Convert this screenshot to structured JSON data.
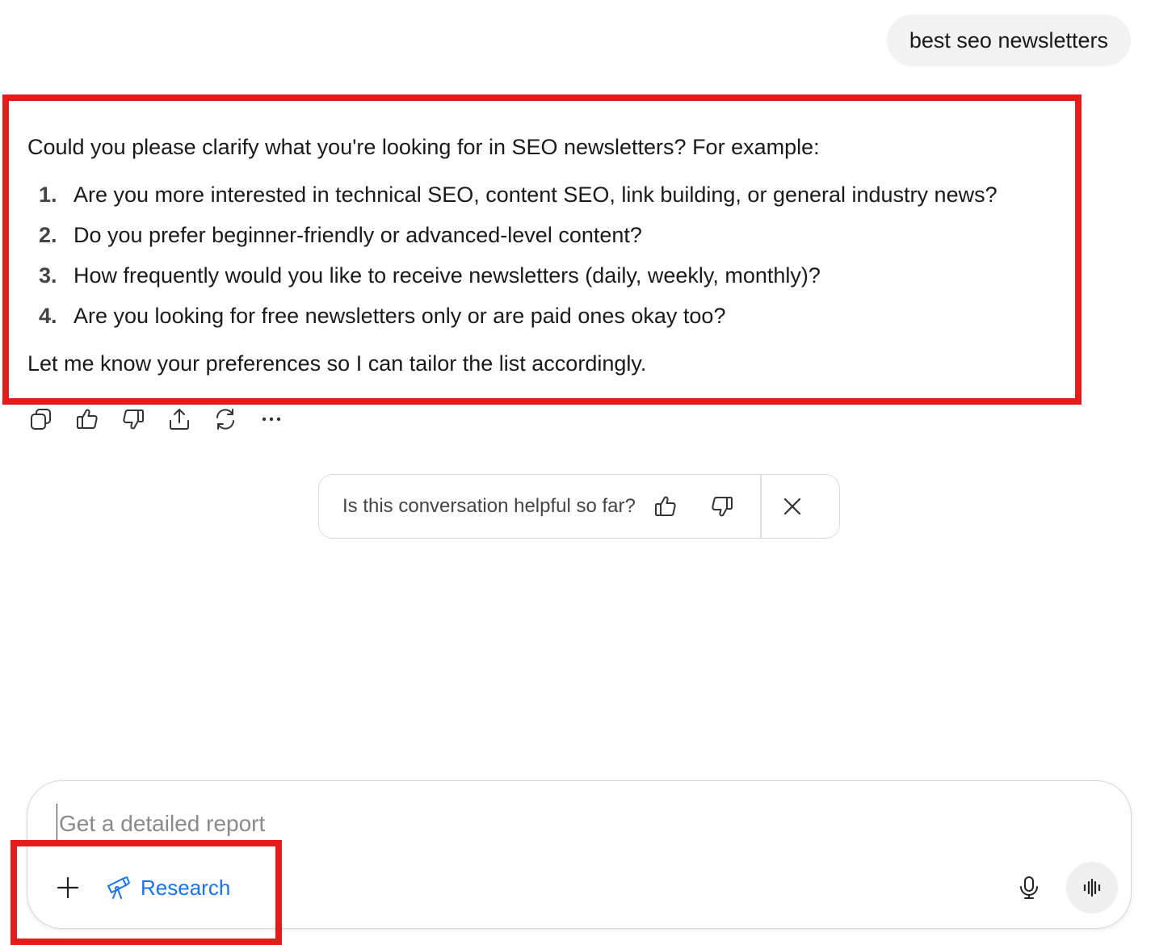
{
  "user_message": "best seo newsletters",
  "answer": {
    "intro": "Could you please clarify what you're looking for in SEO newsletters? For example:",
    "questions": [
      {
        "num": "1.",
        "text": "Are you more interested in technical SEO, content SEO, link building, or general industry news?"
      },
      {
        "num": "2.",
        "text": "Do you prefer beginner-friendly or advanced-level content?"
      },
      {
        "num": "3.",
        "text": "How frequently would you like to receive newsletters (daily, weekly, monthly)?"
      },
      {
        "num": "4.",
        "text": "Are you looking for free newsletters only or are paid ones okay too?"
      }
    ],
    "outro": "Let me know your preferences so I can tailor the list accordingly."
  },
  "actions": [
    "copy-icon",
    "thumbs-up-icon",
    "thumbs-down-icon",
    "share-icon",
    "regenerate-icon",
    "more-icon"
  ],
  "feedback": {
    "question": "Is this conversation helpful so far?"
  },
  "composer": {
    "placeholder": "Get a detailed report",
    "research_label": "Research"
  },
  "colors": {
    "highlight": "#e31b1b",
    "research_accent": "#1a73e8",
    "user_bubble_bg": "#f2f2f2"
  }
}
